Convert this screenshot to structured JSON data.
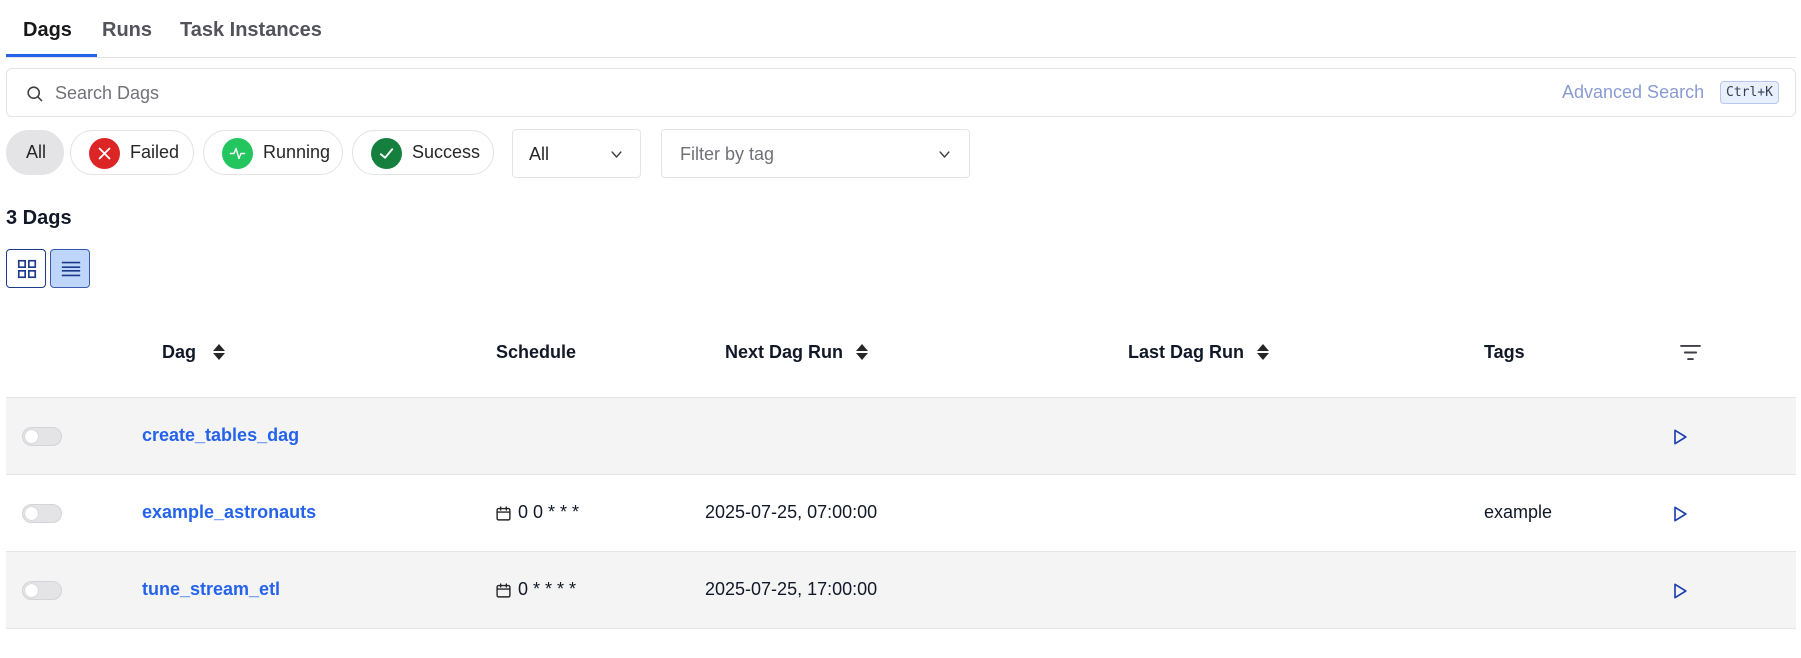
{
  "tabs": [
    {
      "label": "Dags"
    },
    {
      "label": "Runs"
    },
    {
      "label": "Task Instances"
    }
  ],
  "search": {
    "placeholder": "Search Dags",
    "advanced_label": "Advanced Search",
    "shortcut": "Ctrl+K"
  },
  "filters": {
    "all_label": "All",
    "failed_label": "Failed",
    "running_label": "Running",
    "success_label": "Success",
    "paused_select_value": "All",
    "tag_placeholder": "Filter by tag",
    "colors": {
      "failed": "#dc2626",
      "running": "#22c55e",
      "success": "#15803d"
    }
  },
  "summary": {
    "count_text": "3 Dags"
  },
  "view_toggle": {
    "card_icon": "grid-icon",
    "list_icon": "list-icon",
    "active": "list"
  },
  "table": {
    "headers": {
      "dag": "Dag",
      "schedule": "Schedule",
      "next_run": "Next Dag Run",
      "last_run": "Last Dag Run",
      "tags": "Tags"
    },
    "rows": [
      {
        "dag_id": "create_tables_dag",
        "schedule": "",
        "next_run": "",
        "last_run": "",
        "tags": "",
        "paused": true
      },
      {
        "dag_id": "example_astronauts",
        "schedule": "0 0 * * *",
        "next_run": "2025-07-25, 07:00:00",
        "last_run": "",
        "tags": "example",
        "paused": true
      },
      {
        "dag_id": "tune_stream_etl",
        "schedule": "0 * * * *",
        "next_run": "2025-07-25, 17:00:00",
        "last_run": "",
        "tags": "",
        "paused": true
      }
    ]
  },
  "accent_color": "#2563eb"
}
